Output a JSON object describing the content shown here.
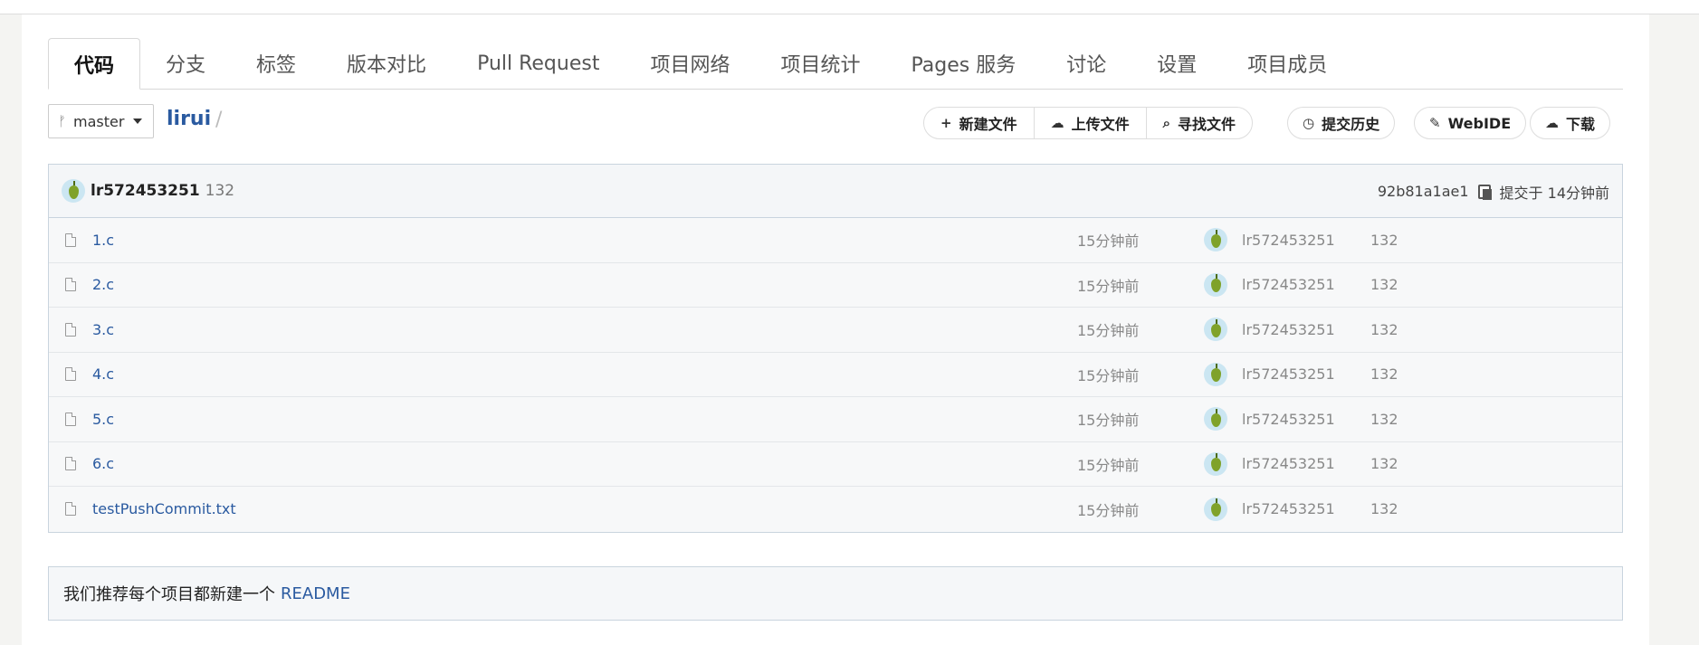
{
  "tabs": [
    {
      "label": "代码",
      "active": true
    },
    {
      "label": "分支"
    },
    {
      "label": "标签"
    },
    {
      "label": "版本对比"
    },
    {
      "label": "Pull Request"
    },
    {
      "label": "项目网络"
    },
    {
      "label": "项目统计"
    },
    {
      "label": "Pages 服务"
    },
    {
      "label": "讨论"
    },
    {
      "label": "设置"
    },
    {
      "label": "项目成员"
    }
  ],
  "toolbar": {
    "branch": "master",
    "repo": "lirui",
    "separator": "/",
    "new_file": "新建文件",
    "upload_file": "上传文件",
    "find_file": "寻找文件",
    "history": "提交历史",
    "webide": "WebIDE",
    "download": "下载"
  },
  "commit": {
    "user": "lr572453251",
    "message": "132",
    "hash": "92b81a1ae1",
    "time": "提交于 14分钟前"
  },
  "files": [
    {
      "name": "1.c",
      "time": "15分钟前",
      "user": "lr572453251",
      "message": "132"
    },
    {
      "name": "2.c",
      "time": "15分钟前",
      "user": "lr572453251",
      "message": "132"
    },
    {
      "name": "3.c",
      "time": "15分钟前",
      "user": "lr572453251",
      "message": "132"
    },
    {
      "name": "4.c",
      "time": "15分钟前",
      "user": "lr572453251",
      "message": "132"
    },
    {
      "name": "5.c",
      "time": "15分钟前",
      "user": "lr572453251",
      "message": "132"
    },
    {
      "name": "6.c",
      "time": "15分钟前",
      "user": "lr572453251",
      "message": "132"
    },
    {
      "name": "testPushCommit.txt",
      "time": "15分钟前",
      "user": "lr572453251",
      "message": "132"
    }
  ],
  "readme": {
    "text": "我们推荐每个项目都新建一个",
    "link": "README"
  },
  "colors": {
    "link": "#2a5aa0",
    "border": "#c9d4de",
    "background": "#f4f4f2"
  }
}
